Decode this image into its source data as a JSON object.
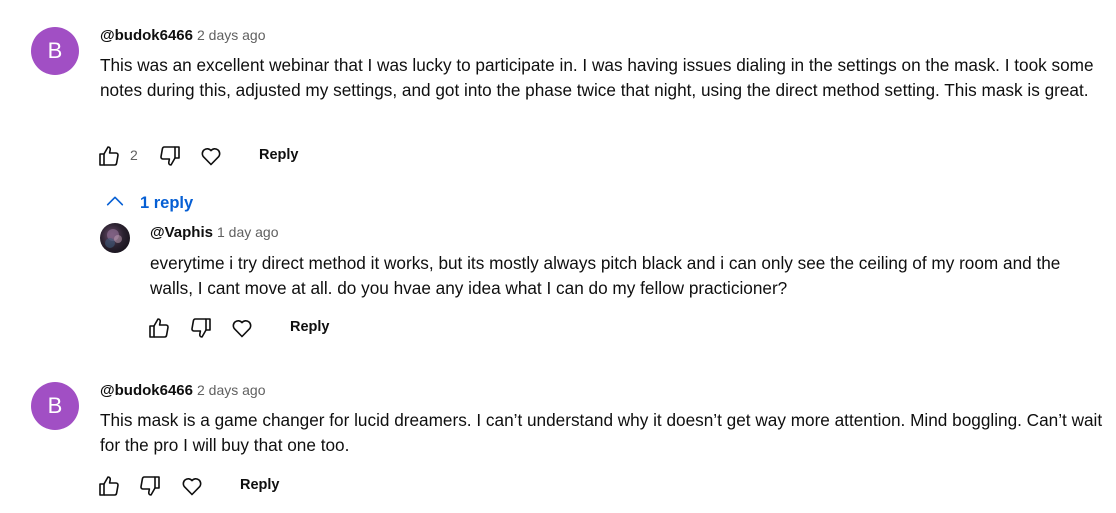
{
  "comments": [
    {
      "avatar_letter": "B",
      "author": "@budok6466",
      "time": "2 days ago",
      "text": "This was an excellent webinar that I was lucky to participate in. I was having issues dialing in the settings on the mask. I took some notes during this, adjusted  my settings, and got into the phase twice that night, using the direct method setting. This mask is great.",
      "like_count": "2",
      "reply_label": "Reply",
      "replies_toggle": "1 reply",
      "replies": [
        {
          "author": "@Vaphis",
          "time": "1 day ago",
          "text": "everytime i try direct method it works, but its mostly always pitch black and i can only see the ceiling of my room and the walls, I cant move at all. do you hvae any idea what I can do my fellow practicioner?",
          "reply_label": "Reply"
        }
      ]
    },
    {
      "avatar_letter": "B",
      "author": "@budok6466",
      "time": "2 days ago",
      "text": "This mask is a game changer for lucid dreamers. I can’t understand why it doesn’t get way more attention. Mind boggling. Can’t wait for the pro I will buy that one too.",
      "reply_label": "Reply"
    }
  ]
}
